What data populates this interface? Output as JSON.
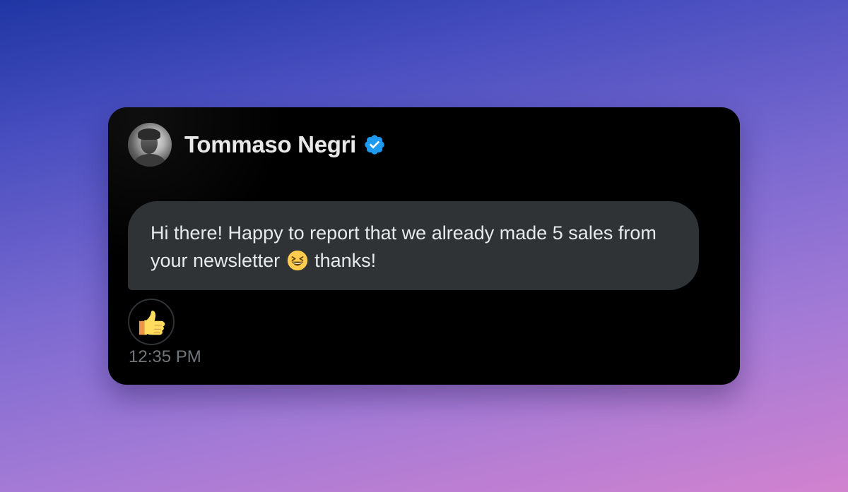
{
  "sender": {
    "name": "Tommaso Negri",
    "verified_icon": "verified-badge-icon",
    "avatar_icon": "avatar"
  },
  "message": {
    "text_before_emoji": "Hi there! Happy to report that we already made 5 sales from your newsletter",
    "emoji": "grinning-squinting-face-icon",
    "text_after_emoji": "thanks!",
    "timestamp": "12:35 PM"
  },
  "reaction": {
    "emoji": "thumbs-up-icon"
  },
  "colors": {
    "card_background": "#000000",
    "bubble_background": "#2f3336",
    "name_text": "#e9e9ea",
    "message_text": "#e7e9ea",
    "timestamp_text": "#71767b",
    "verified_blue": "#1d9bf0"
  }
}
